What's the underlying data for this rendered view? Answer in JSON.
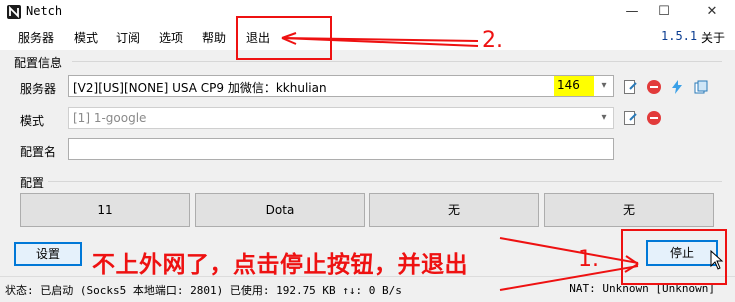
{
  "window": {
    "title": "Netch",
    "minimize": "—",
    "maximize": "☐",
    "close": "✕"
  },
  "menu": {
    "items": [
      "服务器",
      "模式",
      "订阅",
      "选项",
      "帮助",
      "退出"
    ],
    "version": "1.5.1",
    "about": "关于"
  },
  "config": {
    "section_label": "配置信息",
    "server_label": "服务器",
    "server_value": "[V2][US][NONE]  USA  CP9 加微信：kkhulian",
    "server_delay": "146",
    "mode_label": "模式",
    "mode_value": "[1] 1-google",
    "profile_name_label": "配置名",
    "profile_name_value": ""
  },
  "profiles": {
    "section_label": "配置",
    "buttons": [
      "11",
      "Dota",
      "无",
      "无"
    ]
  },
  "actions": {
    "settings": "设置",
    "stop": "停止"
  },
  "status": {
    "left": "状态: 已启动 (Socks5 本地端口: 2801) 已使用: 192.75 KB ↑↓: 0 B/s",
    "right": "NAT: Unknown [Unknown]"
  },
  "annotations": {
    "step2": "2.",
    "step1": "1.",
    "instruction": "不上外网了，点击停止按钮，并退出",
    "color": "#ee1111"
  },
  "colors": {
    "delay_highlight": "#ffff00",
    "focus_blue": "#0078d7",
    "version_blue": "#0b3d91"
  }
}
